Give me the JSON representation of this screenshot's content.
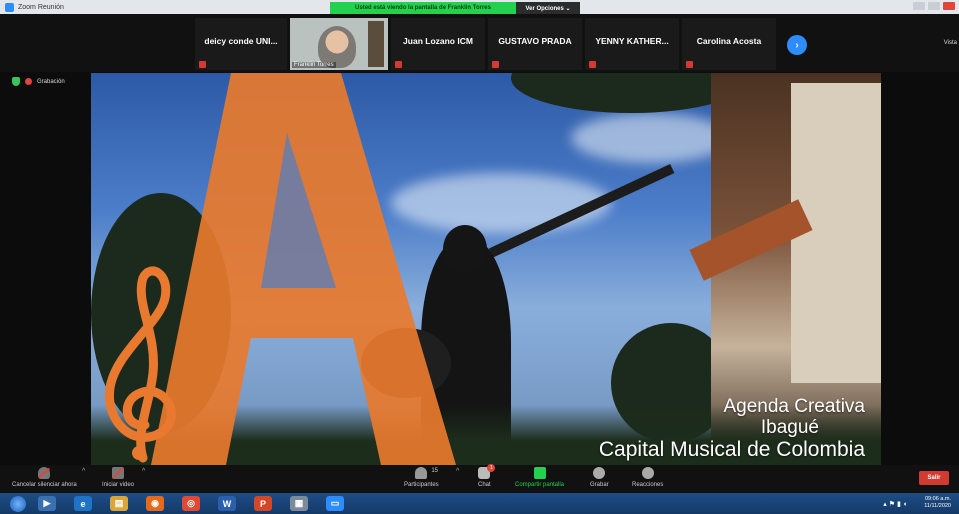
{
  "window": {
    "title": "Zoom Reunión"
  },
  "banner": {
    "share_text": "Usted está viendo la pantalla de Franklin Torres",
    "view_options": "Ver Opciones ⌄"
  },
  "participants": [
    {
      "name": "deicy conde UNI..."
    },
    {
      "name": "Franklin Torres",
      "video": true
    },
    {
      "name": "Juan Lozano ICM"
    },
    {
      "name": "GUSTAVO PRADA"
    },
    {
      "name": "YENNY KATHER..."
    },
    {
      "name": "Carolina Acosta"
    }
  ],
  "view_label": "Vista",
  "recording": {
    "label": "Grabación"
  },
  "shared": {
    "caption_line1": "Agenda Creativa",
    "caption_line2": "Ibagué",
    "caption_line3": "Capital Musical de Colombia"
  },
  "toolbar": {
    "mute": "Cancelar silenciar ahora",
    "video": "Iniciar video",
    "participants": "Participantes",
    "participants_count": "15",
    "chat": "Chat",
    "chat_badge": "1",
    "share": "Compartir pantalla",
    "record": "Grabar",
    "reactions": "Reacciones",
    "leave": "Salir"
  },
  "taskbar": {
    "time": "09:06 a.m.",
    "date": "11/11/2020"
  },
  "colors": {
    "accent": "#2d8cff",
    "share_green": "#23d14e",
    "letter_orange": "#e8792e",
    "leave_red": "#d23b32"
  }
}
